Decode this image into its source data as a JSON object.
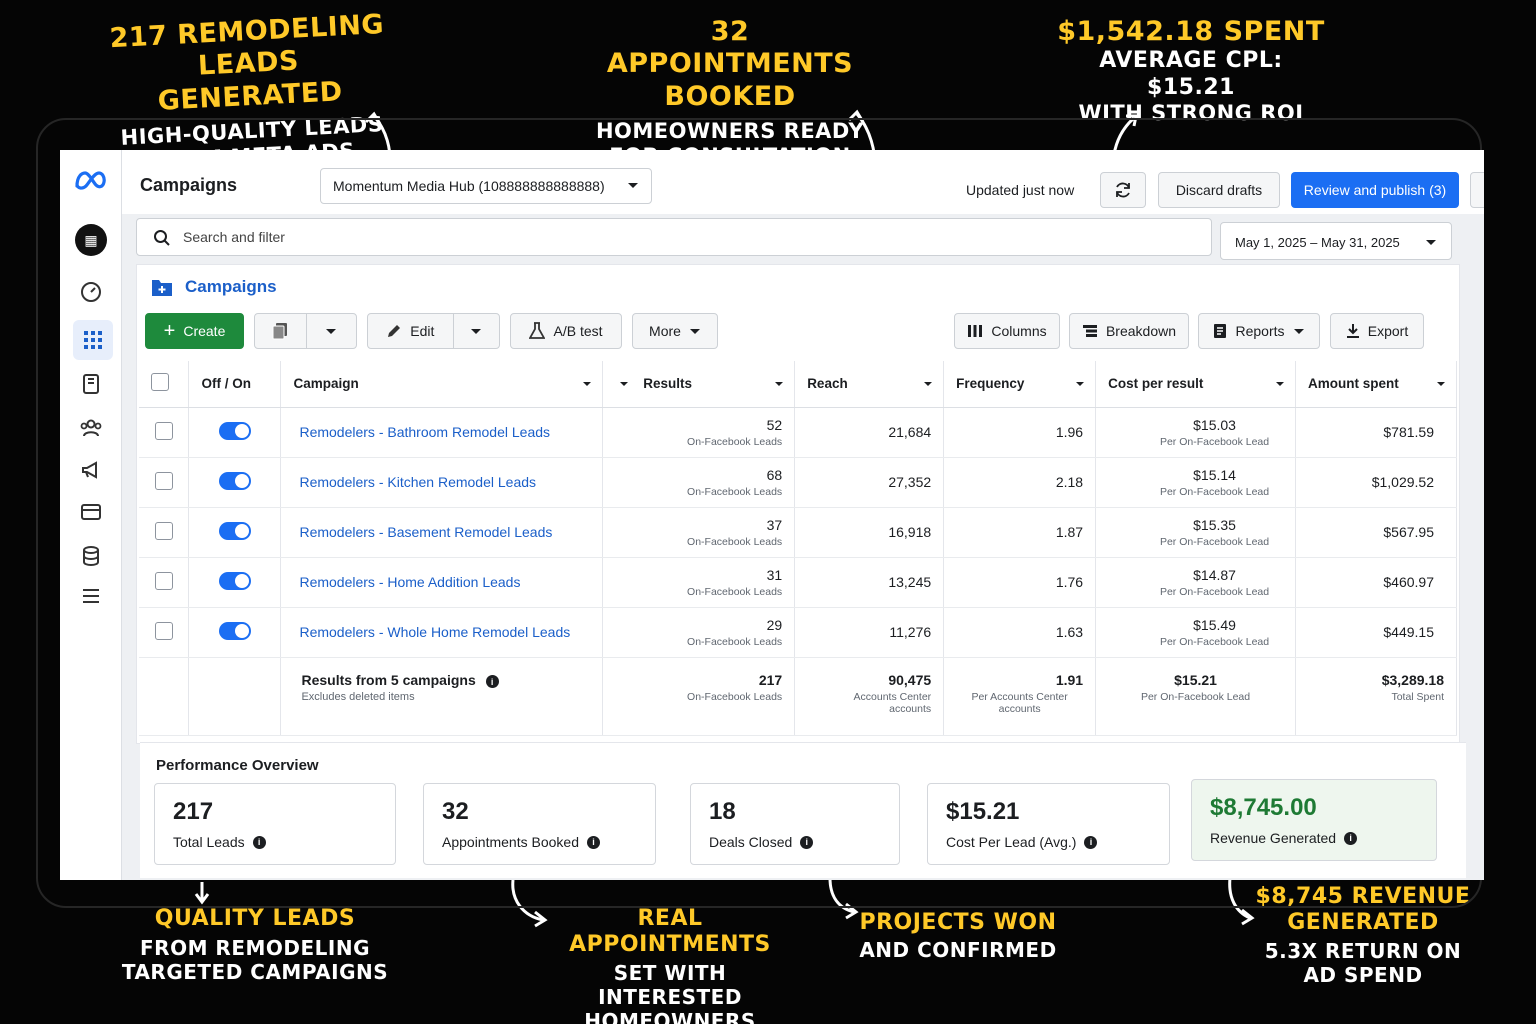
{
  "annotations": {
    "top_left": {
      "line1": "217 Remodeling",
      "line2": "Leads Generated",
      "line3": "High-Quality Leads",
      "line4": "From Meta Ads"
    },
    "top_center": {
      "line1": "32 Appointments",
      "line2": "Booked",
      "line3": "Homeowners Ready",
      "line4": "For Consultation"
    },
    "top_right": {
      "line1": "$1,542.18 Spent",
      "line2": "Average CPL: $15.21",
      "line3": "With Strong ROI"
    },
    "bottom_1": {
      "line1": "Quality Leads",
      "line2": "From Remodeling",
      "line3": "Targeted Campaigns"
    },
    "bottom_2": {
      "line1": "Real Appointments",
      "line2": "Set With Interested",
      "line3": "Homeowners"
    },
    "bottom_3": {
      "line1": "Projects Won",
      "line2": "And Confirmed"
    },
    "bottom_4": {
      "line1": "$8,745 Revenue",
      "line2": "Generated",
      "line3": "5.3X Return On",
      "line4": "Ad Spend"
    }
  },
  "header": {
    "title": "Campaigns",
    "account": "Momentum Media Hub (108888888888888)",
    "updated": "Updated just now",
    "discard": "Discard drafts",
    "publish": "Review and publish (3)",
    "more": "⋯"
  },
  "search": {
    "placeholder": "Search and filter"
  },
  "date_range": "May 1, 2025 – May 31, 2025",
  "panel": {
    "title": "Campaigns",
    "toolbar": {
      "create": "Create",
      "edit": "Edit",
      "ab_test": "A/B test",
      "more": "More",
      "columns": "Columns",
      "breakdown": "Breakdown",
      "reports": "Reports",
      "export": "Export"
    }
  },
  "table": {
    "columns": {
      "toggle": "Off / On",
      "campaign": "Campaign",
      "results": "Results",
      "reach": "Reach",
      "frequency": "Frequency",
      "cpr": "Cost per result",
      "amount": "Amount spent"
    },
    "rows": [
      {
        "name": "Remodelers - Bathroom Remodel Leads",
        "results": "52",
        "results_sub": "On-Facebook Leads",
        "reach": "21,684",
        "frequency": "1.96",
        "cpr": "$15.03",
        "cpr_sub": "Per On-Facebook Lead",
        "amount": "$781.59"
      },
      {
        "name": "Remodelers - Kitchen Remodel Leads",
        "results": "68",
        "results_sub": "On-Facebook Leads",
        "reach": "27,352",
        "frequency": "2.18",
        "cpr": "$15.14",
        "cpr_sub": "Per On-Facebook Lead",
        "amount": "$1,029.52"
      },
      {
        "name": "Remodelers - Basement Remodel Leads",
        "results": "37",
        "results_sub": "On-Facebook Leads",
        "reach": "16,918",
        "frequency": "1.87",
        "cpr": "$15.35",
        "cpr_sub": "Per On-Facebook Lead",
        "amount": "$567.95"
      },
      {
        "name": "Remodelers - Home Addition Leads",
        "results": "31",
        "results_sub": "On-Facebook Leads",
        "reach": "13,245",
        "frequency": "1.76",
        "cpr": "$14.87",
        "cpr_sub": "Per On-Facebook Lead",
        "amount": "$460.97"
      },
      {
        "name": "Remodelers - Whole Home Remodel Leads",
        "results": "29",
        "results_sub": "On-Facebook Leads",
        "reach": "11,276",
        "frequency": "1.63",
        "cpr": "$15.49",
        "cpr_sub": "Per On-Facebook Lead",
        "amount": "$449.15"
      }
    ],
    "totals": {
      "label": "Results from 5 campaigns",
      "label_sub": "Excludes deleted items",
      "results": "217",
      "results_sub": "On-Facebook Leads",
      "reach": "90,475",
      "reach_sub": "Accounts Center accounts",
      "frequency": "1.91",
      "frequency_sub": "Per Accounts Center accounts",
      "cpr": "$15.21",
      "cpr_sub": "Per On-Facebook Lead",
      "amount": "$3,289.18",
      "amount_sub": "Total Spent"
    }
  },
  "overview": {
    "title": "Performance Overview",
    "kpis": [
      {
        "value": "217",
        "label": "Total Leads"
      },
      {
        "value": "32",
        "label": "Appointments Booked"
      },
      {
        "value": "18",
        "label": "Deals Closed"
      },
      {
        "value": "$15.21",
        "label": "Cost Per Lead (Avg.)"
      },
      {
        "value": "$8,745.00",
        "label": "Revenue Generated"
      }
    ]
  },
  "colors": {
    "accent": "#1b6ef3",
    "create": "#1e8a3c",
    "highlight": "#ffc928",
    "revenue": "#1e7a34"
  }
}
